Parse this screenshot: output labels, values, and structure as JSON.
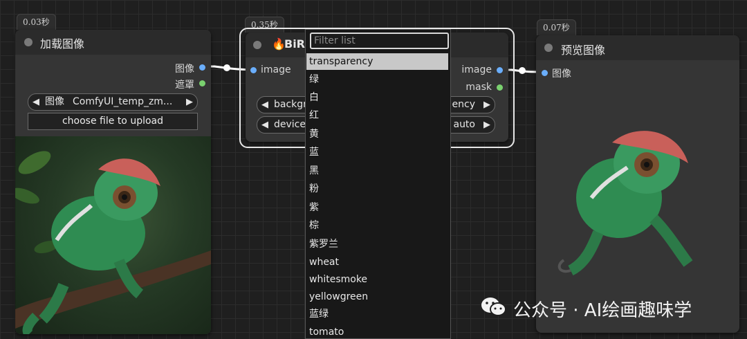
{
  "nodes": {
    "load": {
      "time": "0.03秒",
      "title": "加载图像",
      "out_image": "图像",
      "out_mask": "遮罩",
      "widget_label": "图像",
      "widget_value": "ComfyUI_temp_zm...",
      "upload": "choose file to upload"
    },
    "birefnet": {
      "time": "0.35秒",
      "title": "BiR",
      "in_image": "image",
      "out_image": "image",
      "out_mask": "mask",
      "w1_left": "backgr",
      "w1_right": "ency",
      "w2_left": "device",
      "w2_right": "auto"
    },
    "preview": {
      "time": "0.07秒",
      "title": "预览图像",
      "in_image": "图像"
    }
  },
  "dropdown": {
    "filter_placeholder": "Filter list",
    "options": [
      "transparency",
      "绿",
      "白",
      "红",
      "黄",
      "蓝",
      "黑",
      "粉",
      "紫",
      "棕",
      "紫罗兰",
      "wheat",
      "whitesmoke",
      "yellowgreen",
      "蓝绿",
      "tomato"
    ],
    "selected": "transparency"
  },
  "watermark": "公众号 · AI绘画趣味学",
  "colors": {
    "canvas": "#1f1f1f",
    "node_body": "#353535",
    "node_title": "#2b2b2b",
    "port_image": "#6aaefc",
    "port_mask": "#7ad16f"
  }
}
